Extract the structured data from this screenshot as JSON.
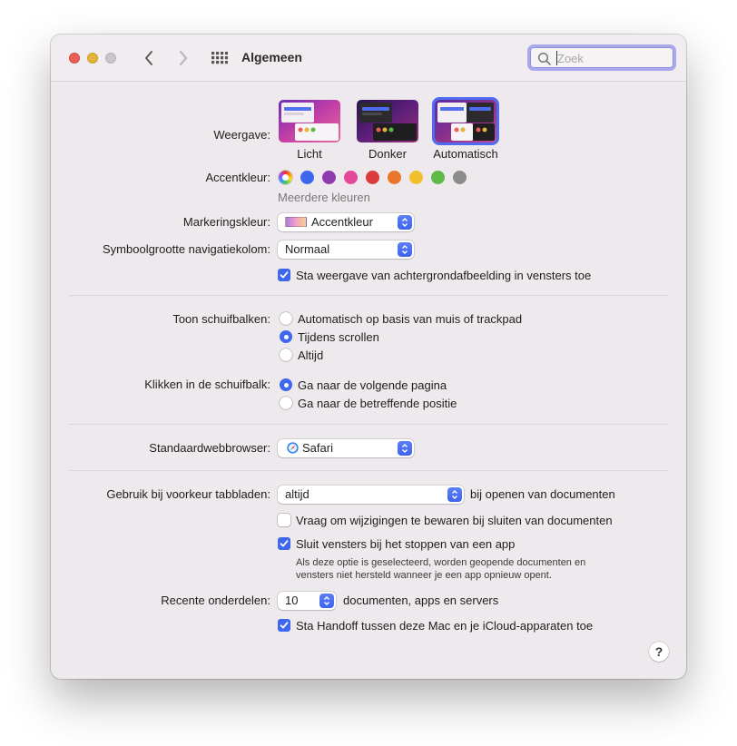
{
  "window": {
    "title": "Algemeen"
  },
  "search": {
    "placeholder": "Zoek"
  },
  "appearance": {
    "label": "Weergave:",
    "options": [
      {
        "name": "Licht"
      },
      {
        "name": "Donker"
      },
      {
        "name": "Automatisch",
        "selected": true
      }
    ]
  },
  "accent": {
    "label": "Accentkleur:",
    "colors": [
      "multicolor",
      "#3f67ee",
      "#8f3bb0",
      "#e5489b",
      "#dc3b3b",
      "#e8762c",
      "#f2c02f",
      "#5dba48",
      "#8c8c8c"
    ],
    "selected_name": "Meerdere kleuren"
  },
  "highlight": {
    "label": "Markeringskleur:",
    "value": "Accentkleur"
  },
  "sidebar_icon": {
    "label": "Symboolgrootte navigatiekolom:",
    "value": "Normaal"
  },
  "wallpaper_tinting": {
    "label": "Sta weergave van achtergrondafbeelding in vensters toe",
    "checked": true
  },
  "scrollbars": {
    "label": "Toon schuifbalken:",
    "options": [
      "Automatisch op basis van muis of trackpad",
      "Tijdens scrollen",
      "Altijd"
    ],
    "selected": "Tijdens scrollen"
  },
  "scrollbar_click": {
    "label": "Klikken in de schuifbalk:",
    "options": [
      "Ga naar de volgende pagina",
      "Ga naar de betreffende positie"
    ],
    "selected": "Ga naar de volgende pagina"
  },
  "browser": {
    "label": "Standaardwebbrowser:",
    "value": "Safari"
  },
  "tabs": {
    "label": "Gebruik bij voorkeur tabbladen:",
    "value": "altijd",
    "suffix": "bij openen van documenten"
  },
  "ask_keep_changes": {
    "label": "Vraag om wijzigingen te bewaren bij sluiten van documenten",
    "checked": false
  },
  "close_windows": {
    "label": "Sluit vensters bij het stoppen van een app",
    "checked": true,
    "description": "Als deze optie is geselecteerd, worden geopende documenten en vensters niet hersteld wanneer je een app opnieuw opent."
  },
  "recent": {
    "label": "Recente onderdelen:",
    "value": "10",
    "suffix": "documenten, apps en servers"
  },
  "handoff": {
    "label": "Sta Handoff tussen deze Mac en je iCloud-apparaten toe",
    "checked": true
  },
  "help": {
    "label": "?"
  }
}
